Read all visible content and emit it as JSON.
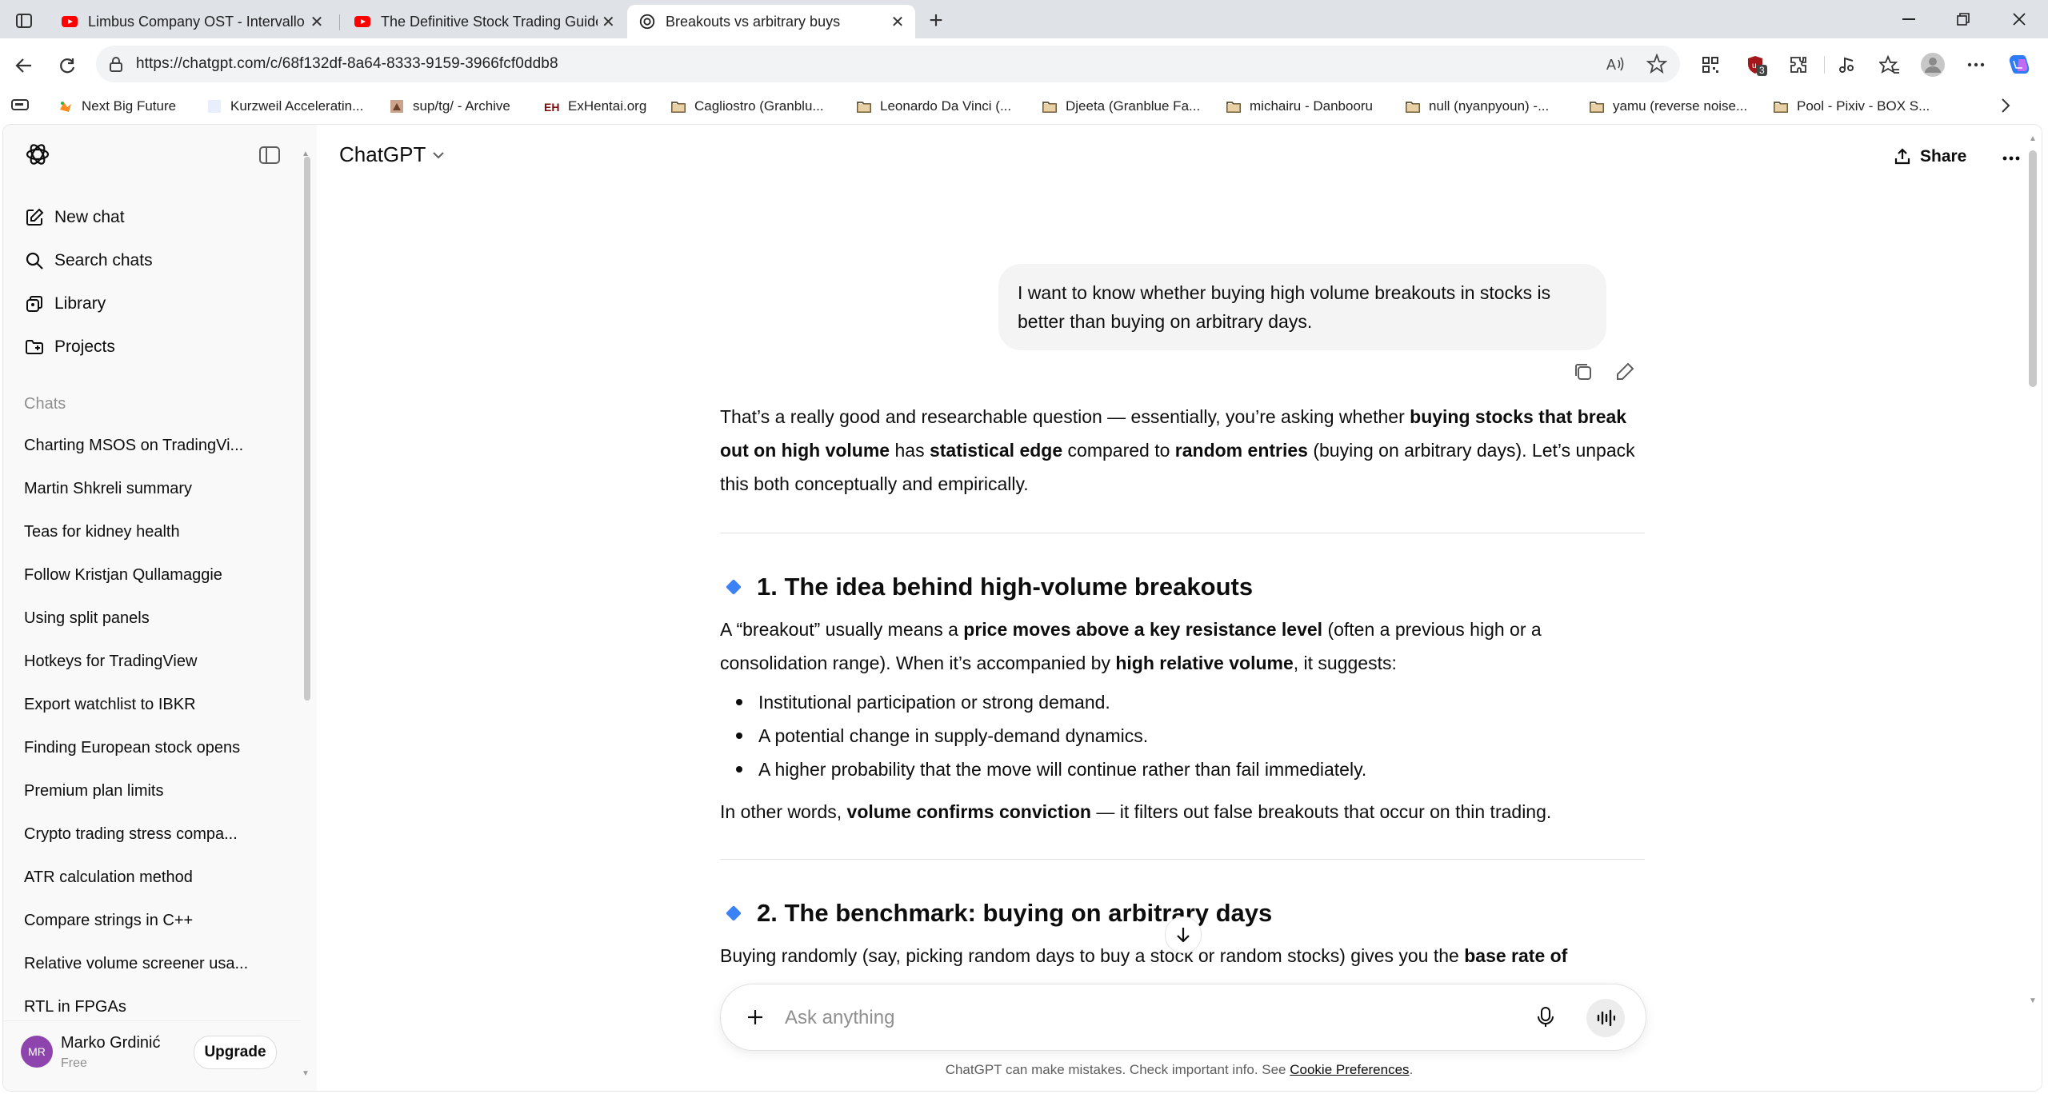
{
  "browser": {
    "tabs": [
      {
        "title": "Limbus Company OST - Intervallo",
        "favicon": "youtube-icon",
        "active": false
      },
      {
        "title": "The Definitive Stock Trading Guide",
        "favicon": "youtube-icon",
        "active": false
      },
      {
        "title": "Breakouts vs arbitrary buys",
        "favicon": "chatgpt-icon",
        "active": true
      }
    ],
    "new_tab": "+",
    "url": "https://chatgpt.com/c/68f132df-8a64-8333-9159-3966fcf0ddb8",
    "extension_badge": "3",
    "bookmarks": [
      {
        "label": "Next Big Future",
        "icon": "bookmark-icon"
      },
      {
        "label": "Kurzweil Acceleratin...",
        "icon": "bookmark-icon"
      },
      {
        "label": "sup/tg/ - Archive",
        "icon": "bookmark-icon"
      },
      {
        "label": "ExHentai.org",
        "icon": "bookmark-icon"
      },
      {
        "label": "Cagliostro (Granblu...",
        "icon": "folder-icon"
      },
      {
        "label": "Leonardo Da Vinci (...",
        "icon": "folder-icon"
      },
      {
        "label": "Djeeta (Granblue Fa...",
        "icon": "folder-icon"
      },
      {
        "label": "michairu - Danbooru",
        "icon": "folder-icon"
      },
      {
        "label": "null (nyanpyoun) -...",
        "icon": "folder-icon"
      },
      {
        "label": "yamu (reverse noise...",
        "icon": "folder-icon"
      },
      {
        "label": "Pool - Pixiv - BOX S...",
        "icon": "folder-icon"
      }
    ]
  },
  "sidebar": {
    "nav": [
      {
        "label": "New chat",
        "icon": "new-chat-icon"
      },
      {
        "label": "Search chats",
        "icon": "search-icon"
      },
      {
        "label": "Library",
        "icon": "library-icon"
      },
      {
        "label": "Projects",
        "icon": "projects-icon"
      }
    ],
    "chats_label": "Chats",
    "chats": [
      "Charting MSOS on TradingVi...",
      "Martin Shkreli summary",
      "Teas for kidney health",
      "Follow Kristjan Qullamaggie",
      "Using split panels",
      "Hotkeys for TradingView",
      "Export watchlist to IBKR",
      "Finding European stock opens",
      "Premium plan limits",
      "Crypto trading stress compa...",
      "ATR calculation method",
      "Compare strings in C++",
      "Relative volume screener usa...",
      "RTL in FPGAs"
    ],
    "user": {
      "initials": "MR",
      "name": "Marko Grdinić",
      "plan": "Free",
      "upgrade": "Upgrade"
    }
  },
  "header": {
    "model": "ChatGPT",
    "share": "Share"
  },
  "conversation": {
    "user_message": "I want to know whether buying high volume breakouts in stocks is better than buying on arbitrary days.",
    "intro": {
      "t1": "That’s a really good and researchable question — essentially, you’re asking whether ",
      "b1": "buying stocks that break out on high volume",
      "t2": " has ",
      "b2": "statistical edge",
      "t3": " compared to ",
      "b3": "random entries",
      "t4": " (buying on arbitrary days). Let’s unpack this both conceptually and empirically."
    },
    "section1": {
      "heading": "1. The idea behind high-volume breakouts",
      "p1_t1": "A “breakout” usually means a ",
      "p1_b1": "price moves above a key resistance level",
      "p1_t2": " (often a previous high or a consolidation range). When it’s accompanied by ",
      "p1_b2": "high relative volume",
      "p1_t3": ", it suggests:",
      "bullets": [
        "Institutional participation or strong demand.",
        "A potential change in supply-demand dynamics.",
        "A higher probability that the move will continue rather than fail immediately."
      ],
      "p2_t1": "In other words, ",
      "p2_b1": "volume confirms conviction",
      "p2_t2": " — it filters out false breakouts that occur on thin trading."
    },
    "section2": {
      "heading": "2. The benchmark: buying on arbitrary days",
      "p1_t1": "Buying randomly (say, picking random days to buy a stock or random stocks) gives you the ",
      "p1_b1": "base rate of"
    }
  },
  "composer": {
    "placeholder": "Ask anything"
  },
  "footer": {
    "text": "ChatGPT can make mistakes. Check important info. See ",
    "link": "Cookie Preferences",
    "end": "."
  },
  "colors": {
    "accent": "#3b82f6",
    "youtube": "#ff0000",
    "avatar": "#8e44ad"
  }
}
